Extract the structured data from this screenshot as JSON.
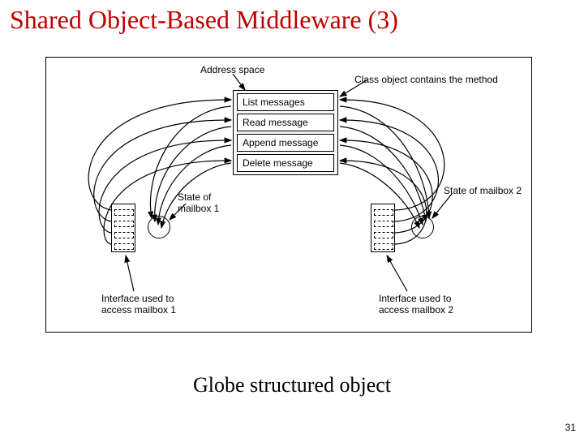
{
  "title": "Shared Object-Based Middleware (3)",
  "caption": "Globe structured object",
  "page_number": "31",
  "labels": {
    "address_space": "Address space",
    "class_object": "Class object contains the method",
    "state_mailbox_1": "State of\nmailbox 1",
    "state_mailbox_2": "State of mailbox 2",
    "interface_1": "Interface used to\naccess mailbox 1",
    "interface_2": "Interface used to\naccess mailbox 2"
  },
  "methods": [
    "List messages",
    "Read message",
    "Append message",
    "Delete message"
  ]
}
